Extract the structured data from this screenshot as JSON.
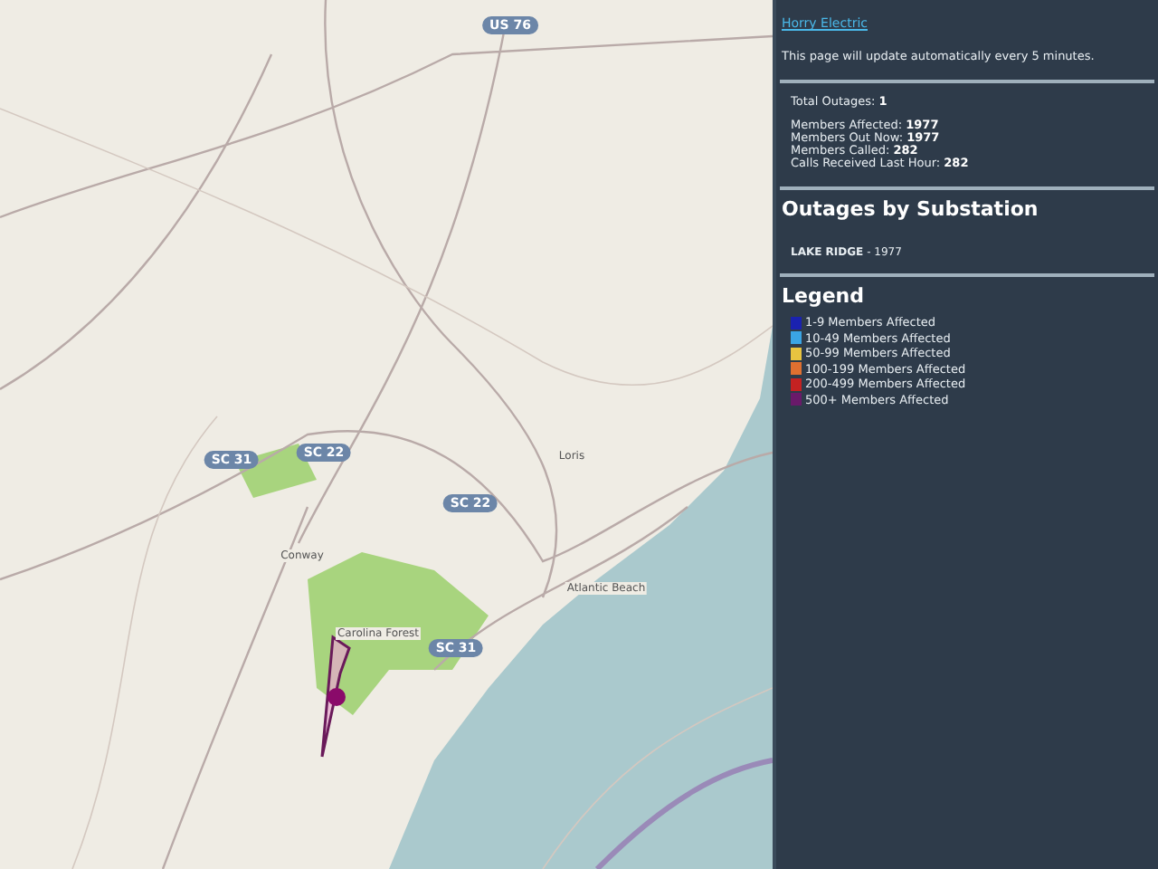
{
  "map": {
    "road_shields": [
      "US 76",
      "SC 31",
      "SC 22",
      "SC 22",
      "SC 31"
    ],
    "places": [
      "Loris",
      "Conway",
      "Carolina Forest",
      "Atlantic Beach"
    ]
  },
  "sidebar": {
    "link": "Horry Electric",
    "notice": "This page will update automatically every 5 minutes.",
    "totals": [
      {
        "label": "Total Outages:",
        "value": "1"
      }
    ],
    "stats": [
      {
        "label": "Members Affected:",
        "value": "1977"
      },
      {
        "label": "Members Out Now:",
        "value": "1977"
      },
      {
        "label": "Members Called:",
        "value": "282"
      },
      {
        "label": "Calls Received Last Hour:",
        "value": "282"
      }
    ],
    "substations_title": "Outages by Substation",
    "substations": [
      {
        "name": "LAKE RIDGE",
        "count": "- 1977"
      }
    ],
    "legend_title": "Legend",
    "legend": [
      {
        "label": "1-9 Members Affected",
        "color": "#1a22b0"
      },
      {
        "label": "10-49 Members Affected",
        "color": "#3aa4e4"
      },
      {
        "label": "50-99 Members Affected",
        "color": "#e8c440"
      },
      {
        "label": "100-199 Members Affected",
        "color": "#e07030"
      },
      {
        "label": "200-499 Members Affected",
        "color": "#c42222"
      },
      {
        "label": "500+ Members Affected",
        "color": "#6a1a6a"
      }
    ]
  }
}
